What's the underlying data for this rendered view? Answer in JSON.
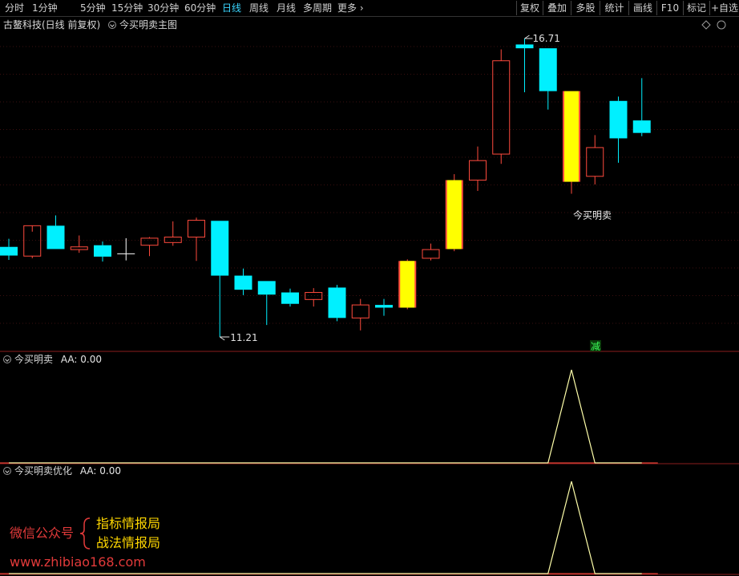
{
  "toolbar": {
    "periods": [
      "分时",
      "1分钟",
      "5分钟",
      "15分钟",
      "30分钟",
      "60分钟",
      "日线",
      "周线",
      "月线",
      "多周期",
      "更多"
    ],
    "active_period": "日线",
    "right_buttons": [
      "复权",
      "叠加",
      "多股",
      "统计",
      "画线",
      "F10",
      "标记",
      "+自选"
    ]
  },
  "main_panel": {
    "stock_title": "古鳌科技(日线 前复权)",
    "indicator_label": "今买明卖主图",
    "high_label": "16.71",
    "low_label": "11.21",
    "signal_label": "今买明卖",
    "reduce_label": "减"
  },
  "sub_panel_1": {
    "title": "今买明卖",
    "aa_text": "AA: 0.00"
  },
  "sub_panel_2": {
    "title": "今买明卖优化",
    "aa_text": "AA: 0.00"
  },
  "watermark": {
    "wechat_label": "微信公众号",
    "account_1": "指标情报局",
    "account_2": "战法情报局",
    "website": "www.zhibiao168.com"
  },
  "colors": {
    "up": "#ff4a3d",
    "down": "#00f0ff",
    "signal": "#ffff00",
    "panel_line": "#ffffaa",
    "divider": "#8b1e1e",
    "wechat": "#e23a3a",
    "account": "#ffd700"
  },
  "chart_data": {
    "type": "candlestick",
    "price_range": [
      10.8,
      17.3
    ],
    "candles": [
      {
        "o": 12.87,
        "h": 13.02,
        "l": 12.63,
        "c": 12.71,
        "kind": "down"
      },
      {
        "o": 12.7,
        "h": 13.15,
        "l": 12.66,
        "c": 13.26,
        "kind": "up"
      },
      {
        "o": 13.26,
        "h": 13.45,
        "l": 12.83,
        "c": 12.83,
        "kind": "down"
      },
      {
        "o": 12.82,
        "h": 13.08,
        "l": 12.76,
        "c": 12.87,
        "kind": "up"
      },
      {
        "o": 12.9,
        "h": 12.97,
        "l": 12.6,
        "c": 12.69,
        "kind": "down"
      },
      {
        "o": 12.75,
        "h": 13.03,
        "l": 12.62,
        "c": 12.75,
        "kind": "flat"
      },
      {
        "o": 12.9,
        "h": 13.05,
        "l": 12.7,
        "c": 13.03,
        "kind": "up"
      },
      {
        "o": 12.95,
        "h": 13.34,
        "l": 12.89,
        "c": 13.05,
        "kind": "up"
      },
      {
        "o": 13.05,
        "h": 13.41,
        "l": 12.61,
        "c": 13.36,
        "kind": "up"
      },
      {
        "o": 13.35,
        "h": 13.35,
        "l": 11.21,
        "c": 12.34,
        "kind": "down"
      },
      {
        "o": 12.34,
        "h": 12.47,
        "l": 11.98,
        "c": 12.08,
        "kind": "down"
      },
      {
        "o": 12.24,
        "h": 12.24,
        "l": 11.43,
        "c": 11.99,
        "kind": "down"
      },
      {
        "o": 12.03,
        "h": 12.1,
        "l": 11.77,
        "c": 11.82,
        "kind": "down"
      },
      {
        "o": 11.9,
        "h": 12.11,
        "l": 11.77,
        "c": 12.03,
        "kind": "up"
      },
      {
        "o": 12.12,
        "h": 12.17,
        "l": 11.5,
        "c": 11.56,
        "kind": "down"
      },
      {
        "o": 11.56,
        "h": 11.91,
        "l": 11.33,
        "c": 11.8,
        "kind": "up"
      },
      {
        "o": 11.8,
        "h": 11.91,
        "l": 11.6,
        "c": 11.75,
        "kind": "down"
      },
      {
        "o": 11.75,
        "h": 12.64,
        "l": 11.72,
        "c": 12.61,
        "kind": "signal"
      },
      {
        "o": 12.66,
        "h": 12.93,
        "l": 12.62,
        "c": 12.82,
        "kind": "up"
      },
      {
        "o": 12.83,
        "h": 14.21,
        "l": 12.79,
        "c": 14.1,
        "kind": "signal"
      },
      {
        "o": 14.1,
        "h": 14.72,
        "l": 13.9,
        "c": 14.46,
        "kind": "up"
      },
      {
        "o": 14.58,
        "h": 16.51,
        "l": 14.4,
        "c": 16.3,
        "kind": "up"
      },
      {
        "o": 16.6,
        "h": 16.71,
        "l": 15.72,
        "c": 16.53,
        "kind": "down"
      },
      {
        "o": 16.53,
        "h": 16.53,
        "l": 15.4,
        "c": 15.74,
        "kind": "down"
      },
      {
        "o": 15.74,
        "h": 15.74,
        "l": 13.85,
        "c": 14.07,
        "kind": "signal"
      },
      {
        "o": 14.17,
        "h": 14.93,
        "l": 14.02,
        "c": 14.7,
        "kind": "up"
      },
      {
        "o": 14.87,
        "h": 15.64,
        "l": 14.42,
        "c": 15.56,
        "kind": "down"
      },
      {
        "o": 15.2,
        "h": 15.98,
        "l": 14.91,
        "c": 14.97,
        "kind": "down"
      }
    ],
    "sub_1": {
      "values": [
        0,
        0,
        0,
        0,
        0,
        0,
        0,
        0,
        0,
        0,
        0,
        0,
        0,
        0,
        0,
        0,
        0,
        0,
        0,
        0,
        0,
        0,
        0,
        0,
        1,
        0,
        0,
        0
      ],
      "ylim": [
        0,
        1
      ]
    },
    "sub_2": {
      "values": [
        0,
        0,
        0,
        0,
        0,
        0,
        0,
        0,
        0,
        0,
        0,
        0,
        0,
        0,
        0,
        0,
        0,
        0,
        0,
        0,
        0,
        0,
        0,
        0,
        1,
        0,
        0,
        0
      ],
      "ylim": [
        0,
        1
      ]
    }
  }
}
